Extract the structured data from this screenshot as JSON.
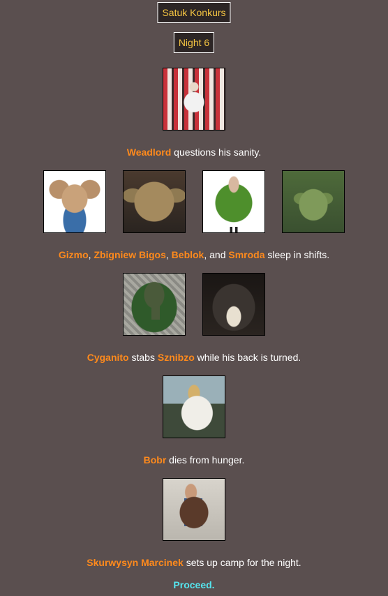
{
  "header": {
    "title": "Satuk Konkurs",
    "night": "Night 6"
  },
  "events": [
    {
      "portraits": [
        "crowd-celebration-photo"
      ],
      "names": [
        "Weadlord"
      ],
      "text_after": " questions his sanity."
    },
    {
      "portraits": [
        "gremlin-photo",
        "yoda-face-photo",
        "avocado-person-photo",
        "green-creature-photo"
      ],
      "names": [
        "Gizmo",
        "Zbigniew Bigos",
        "Beblok",
        "Smroda"
      ],
      "sep": [
        ", ",
        ", ",
        ", and "
      ],
      "text_after": " sleep in shifts."
    },
    {
      "portraits": [
        "keyhole-tomb-aerial-photo",
        "grinning-monkey-photo"
      ],
      "names": [
        "Cyganito",
        "Sznibzo"
      ],
      "text_mid": " stabs ",
      "text_after": " while his back is turned."
    },
    {
      "portraits": [
        "rider-on-white-horse-painting"
      ],
      "names": [
        "Bobr"
      ],
      "text_after": " dies from hunger."
    },
    {
      "portraits": [
        "man-with-disc-photo"
      ],
      "names": [
        "Skurwysyn Marcinek"
      ],
      "text_after": " sets up camp for the night."
    }
  ],
  "proceed_label": "Proceed.",
  "colors": {
    "background": "#5a4f4f",
    "name": "#ff8a1c",
    "title": "#f5c542",
    "link": "#55e5ee"
  }
}
